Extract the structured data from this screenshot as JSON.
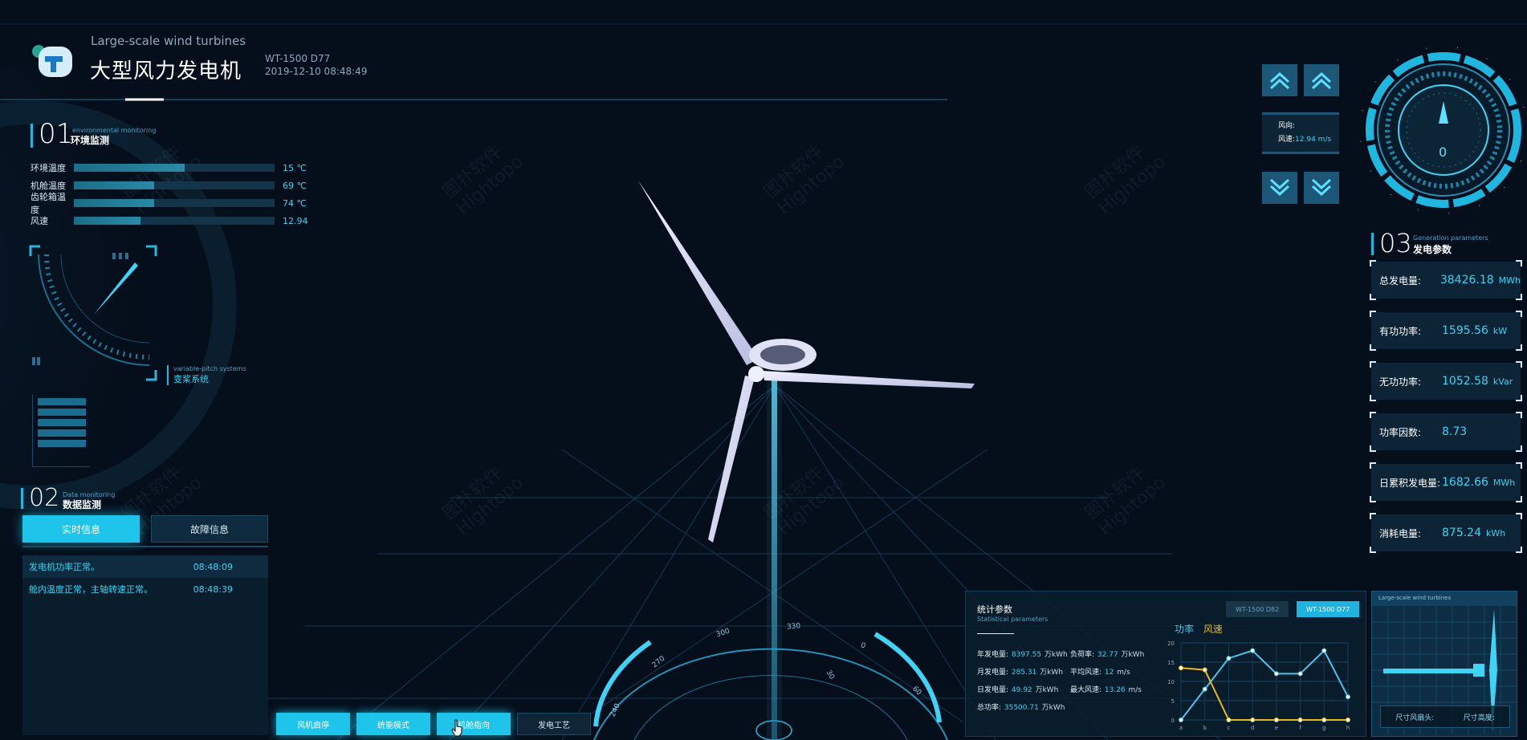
{
  "header": {
    "subtitle": "Large-scale wind turbines",
    "title": "大型风力发电机",
    "model": "WT-1500 D77",
    "datetime": "2019-12-10 08:48:49"
  },
  "env": {
    "num": "01",
    "en": "environmental monitoring",
    "cn": "环境监测",
    "items": [
      {
        "label": "环境温度",
        "value": "15 ℃",
        "level": 0.55
      },
      {
        "label": "机舱温度",
        "value": "69 ℃",
        "level": 0.4
      },
      {
        "label": "齿轮箱温度",
        "value": "74 ℃",
        "level": 0.4
      },
      {
        "label": "风速",
        "value": "12.94",
        "level": 0.33
      }
    ]
  },
  "pitch": {
    "en": "variable-pitch systems",
    "cn": "变桨系统"
  },
  "monitor": {
    "num": "02",
    "en": "Data monitoring",
    "cn": "数据监测",
    "tabs": [
      "实时信息",
      "故障信息"
    ],
    "rows": [
      {
        "text": "发电机功率正常。",
        "time": "08:48:09"
      },
      {
        "text": "舱内温度正常，主轴转速正常。",
        "time": "08:48:39"
      }
    ]
  },
  "wind": {
    "dir_label": "风向:",
    "speed_label": "风速:",
    "speed_value": "12.94 m/s",
    "compass_value": "0"
  },
  "gen": {
    "num": "03",
    "en": "Generation parameters",
    "cn": "发电参数",
    "cards": [
      {
        "label": "总发电量:",
        "value": "38426.18",
        "unit": "MWh"
      },
      {
        "label": "有功功率:",
        "value": "1595.56",
        "unit": "kW"
      },
      {
        "label": "无功功率:",
        "value": "1052.58",
        "unit": "kVar"
      },
      {
        "label": "功率因数:",
        "value": "8.73",
        "unit": ""
      },
      {
        "label": "日累积发电量:",
        "value": "1682.66",
        "unit": "MWh"
      },
      {
        "label": "消耗电量:",
        "value": "875.24",
        "unit": "kWh"
      }
    ]
  },
  "buttons": [
    "风机启停",
    "统能模式",
    "机舱指向",
    "发电工艺"
  ],
  "stats": {
    "title": "统计参数",
    "en": "Statistical parameters",
    "model_tabs": [
      "WT-1500 D82",
      "WT-1500 D77"
    ],
    "left": [
      {
        "label": "年发电量:",
        "value": "8397.55",
        "unit": "万kWh"
      },
      {
        "label": "月发电量:",
        "value": "285.31",
        "unit": "万kWh"
      },
      {
        "label": "日发电量:",
        "value": "49.92",
        "unit": "万kWh"
      },
      {
        "label": "总功率:",
        "value": "35500.71",
        "unit": "万kWh"
      }
    ],
    "right": [
      {
        "label": "负荷率:",
        "value": "32.77",
        "unit": "万kWh"
      },
      {
        "label": "平均风速:",
        "value": "12",
        "unit": "m/s"
      },
      {
        "label": "最大风速:",
        "value": "13.26",
        "unit": "m/s"
      }
    ],
    "legend": [
      "功率",
      "风速"
    ]
  },
  "chart_data": {
    "type": "line",
    "categories": [
      "a",
      "b",
      "c",
      "d",
      "e",
      "f",
      "g",
      "h"
    ],
    "y_ticks": [
      "20",
      "15",
      "10",
      "5",
      "0"
    ],
    "ylim": [
      0,
      20
    ],
    "series": [
      {
        "name": "功率",
        "color": "#4fc3e8",
        "values": [
          0,
          8,
          16,
          18,
          12,
          12,
          18,
          6
        ]
      },
      {
        "name": "风速",
        "color": "#e7b820",
        "values": [
          13.5,
          13,
          0,
          0,
          0,
          0,
          0,
          0
        ]
      }
    ]
  },
  "mini": {
    "title": "Large-scale wind turbines",
    "labels": [
      "尺寸风扇头:",
      "尺寸高度:"
    ]
  },
  "compass_ticks": [
    "330",
    "300",
    "270",
    "240",
    "0",
    "30",
    "60"
  ],
  "watermark": [
    "图扑软件",
    "Hightopo"
  ]
}
